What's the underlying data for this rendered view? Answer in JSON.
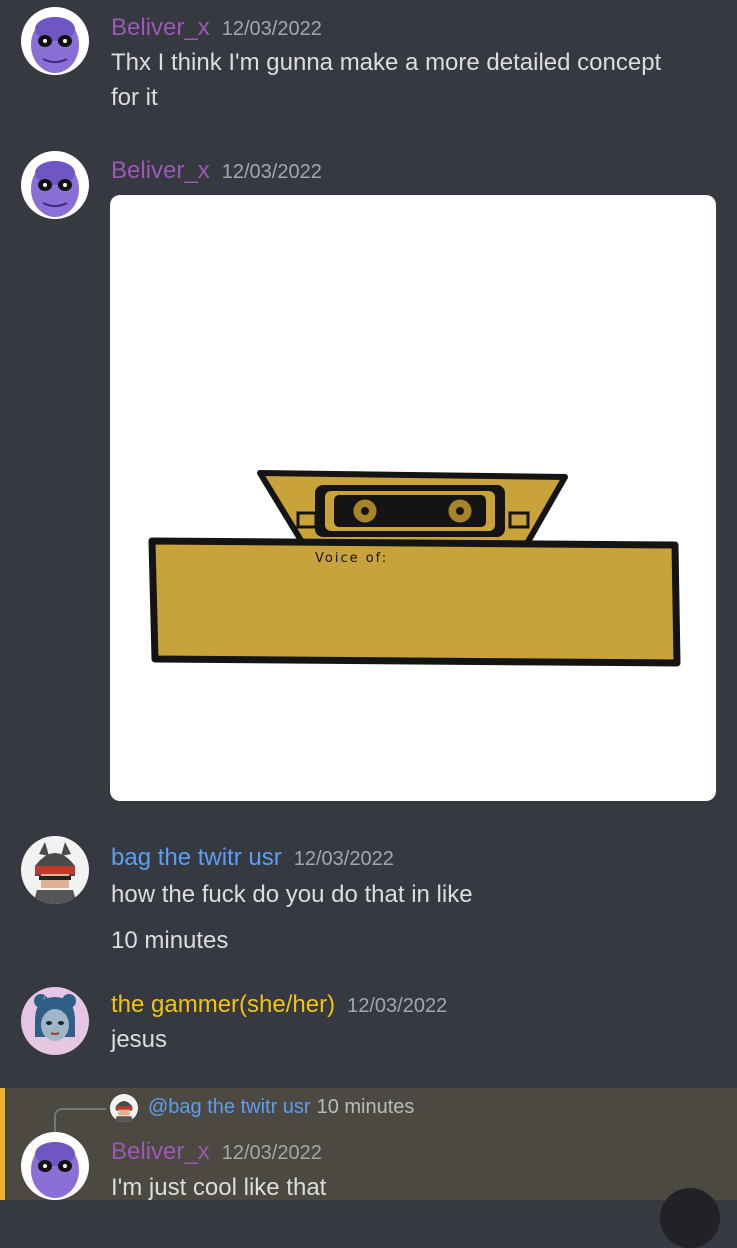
{
  "messages": [
    {
      "author": "Beliver_x",
      "timestamp": "12/03/2022",
      "text_lines": [
        "Thx I think I'm gunna make a more detailed concept",
        "for it"
      ]
    },
    {
      "author": "Beliver_x",
      "timestamp": "12/03/2022",
      "attachment": {
        "caption": "Voice of:"
      }
    },
    {
      "author": "bag the twitr usr",
      "timestamp": "12/03/2022",
      "text_lines": [
        "how the fuck do you do that in like",
        "10 minutes"
      ]
    },
    {
      "author": "the gammer(she/her)",
      "timestamp": "12/03/2022",
      "text_lines": [
        "jesus"
      ]
    },
    {
      "reply": {
        "mention": "@bag the twitr usr",
        "content": "10 minutes"
      },
      "author": "Beliver_x",
      "timestamp": "12/03/2022",
      "text_lines": [
        "I'm just cool like that"
      ]
    }
  ],
  "colors": {
    "background": "#36393f",
    "beliver_name": "#9b59b6",
    "bag_name": "#5a9ff3",
    "gammer_name": "#f1c40f",
    "highlight_row": "#4c4942",
    "highlight_bar": "#f0b232"
  }
}
